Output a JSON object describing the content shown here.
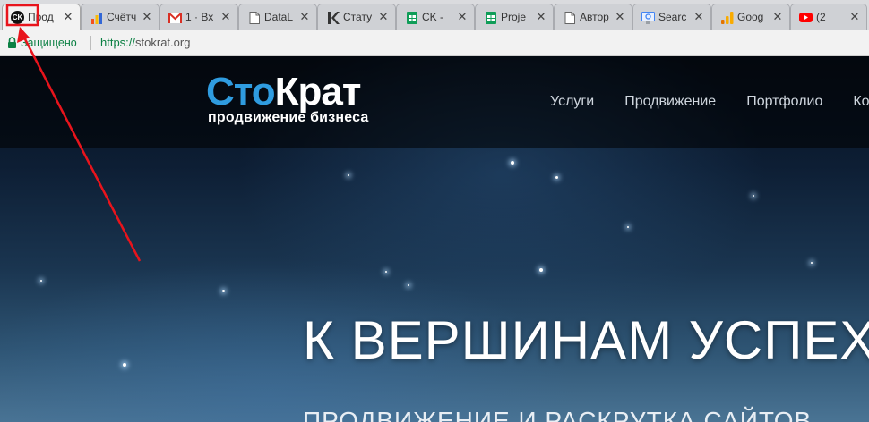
{
  "tabs": [
    {
      "title": "Прод",
      "favicon": "ck-logo-icon",
      "active": true
    },
    {
      "title": "Счётч",
      "favicon": "bar-chart-icon"
    },
    {
      "title": "1 · Вх",
      "favicon": "mail-icon"
    },
    {
      "title": "DataL",
      "favicon": "document-icon"
    },
    {
      "title": "Стату",
      "favicon": "k-logo-icon"
    },
    {
      "title": "CK - ",
      "favicon": "sheets-icon"
    },
    {
      "title": "Proje",
      "favicon": "sheets-icon"
    },
    {
      "title": "Автор",
      "favicon": "document-icon"
    },
    {
      "title": "Searc",
      "favicon": "search-console-icon"
    },
    {
      "title": "Goog",
      "favicon": "analytics-icon"
    },
    {
      "title": "(2",
      "favicon": "youtube-icon"
    }
  ],
  "favicon_text": "CK",
  "address": {
    "security_label": "Защищено",
    "scheme": "https://",
    "host": "stokrat.org"
  },
  "site": {
    "logo_part1": "Сто",
    "logo_part2": "Крат",
    "tagline": "продвижение бизнеса",
    "nav": [
      "Услуги",
      "Продвижение",
      "Портфолио",
      "Ко"
    ],
    "hero_title": "К ВЕРШИНАМ УСПЕХА",
    "hero_subtitle": "ПРОДВИЖЕНИЕ И РАСКРУТКА САЙТОВ"
  },
  "colors": {
    "annotation": "#e8141c",
    "secure_green": "#0b8043",
    "brand_blue": "#2f9ce0"
  }
}
